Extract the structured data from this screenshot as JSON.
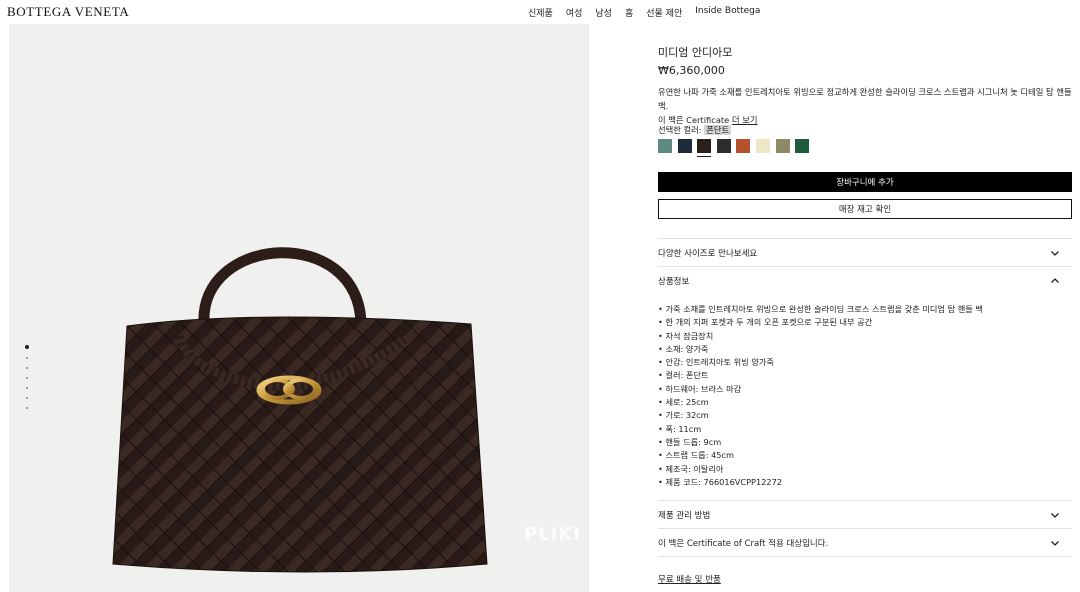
{
  "header": {
    "logo": "BOTTEGA VENETA",
    "nav": [
      "신제품",
      "여성",
      "남성",
      "홈",
      "선물 제안",
      "Inside Bottega"
    ]
  },
  "gallery": {
    "slide_count": 7,
    "active_slide": 1,
    "watermark": "PLIKI"
  },
  "product": {
    "title": "미디엄 안디아모",
    "price": "₩6,360,000",
    "description": "유연한 나파 가죽 소재를 인트레치아토 위빙으로 정교하게 완성한 슬라이딩 크로스 스트랩과 시그니처 놋 디테일 탑 핸들 백.",
    "description_line2": "이 백은 Certificate ",
    "description_link": "더 보기",
    "color_label": "선택한 컬러: ",
    "color_name": "폰단트",
    "swatch_colors": [
      "#5e8a80",
      "#1f2a3a",
      "#2a1f1b",
      "#2c2c2c",
      "#b5522e",
      "#eee7c8",
      "#8f8a66",
      "#1f5a3c"
    ],
    "selected_swatch": 2
  },
  "actions": {
    "add_to_cart": "장바구니에 추가",
    "check_stock": "매장 재고 확인"
  },
  "accordion": {
    "sizes": "다양한 사이즈로 만나보세요",
    "details": "상품정보",
    "care": "제품 관리 방법",
    "craft": "이 백은 Certificate of Craft 적용 대상입니다."
  },
  "specs": [
    "가죽 소재를 인트레치아토 위빙으로 완성한 슬라이딩 크로스 스트랩을 갖춘 미디엄 탑 핸들 백",
    "한 개의 지퍼 포켓과 두 개의 오픈 포켓으로 구분된 내부 공간",
    "자석 잠금장치",
    "소재: 양가죽",
    "안감: 인트레치아토 위빙 양가죽",
    "컬러: 폰단트",
    "하드웨어: 브라스 마감",
    "세로: 25cm",
    "가로: 32cm",
    "폭: 11cm",
    "핸들 드롭: 9cm",
    "스트랩 드롭: 45cm",
    "제조국: 이탈리아",
    "제품 코드: 766016VCPP12272"
  ],
  "shipping_link": "무료 배송 및 반품"
}
